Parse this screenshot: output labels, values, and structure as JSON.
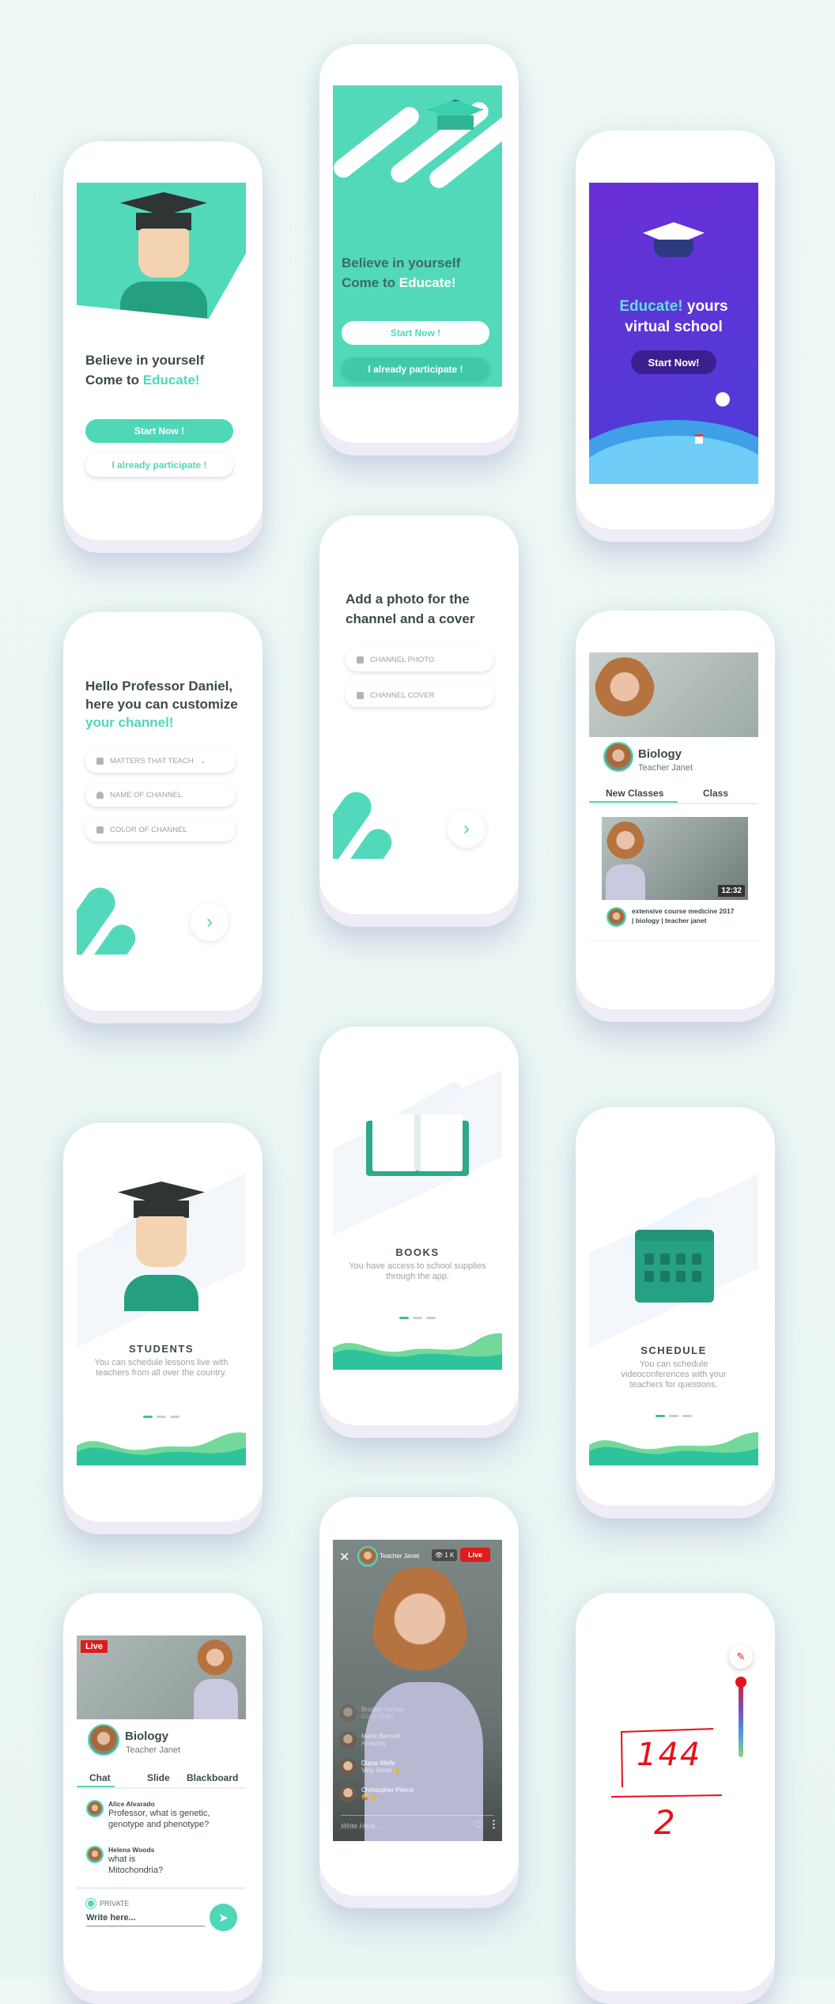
{
  "colors": {
    "background": "#eef8f6",
    "accent": "#4fd8b8",
    "text_dark": "#3b4a4d",
    "text_muted": "#9aa3a6",
    "purple": "#5b36d6",
    "live_red": "#e01b1b"
  },
  "welcome_light": {
    "line1": "Believe in yourself",
    "line2_prefix": "Come to ",
    "brand": "Educate!",
    "start": "Start Now !",
    "participate": "I already participate !"
  },
  "welcome_teal": {
    "line1": "Believe in yourself",
    "line2_prefix": "Come to ",
    "brand": "Educate!",
    "start": "Start Now !",
    "participate": "I already participate !"
  },
  "welcome_purple": {
    "brand": "Educate!",
    "line1_rest": " yours",
    "line2": "virtual school",
    "start": "Start Now!"
  },
  "customize": {
    "line1": "Hello Professor Daniel,",
    "line2": "here you can customize",
    "line3": "your channel!",
    "fields": [
      {
        "icon": "book-icon",
        "label": "MATTERS THAT TEACH"
      },
      {
        "icon": "user-icon",
        "label": "NAME OF CHANNEL"
      },
      {
        "icon": "layers-icon",
        "label": "COLOR OF CHANNEL"
      }
    ]
  },
  "add_photo": {
    "line1": "Add a photo for the",
    "line2": "channel and a cover",
    "fields": [
      {
        "icon": "image-icon",
        "label": "CHANNEL PHOTO"
      },
      {
        "icon": "image-icon",
        "label": "CHANNEL COVER"
      }
    ]
  },
  "channel": {
    "subject": "Biology",
    "teacher": "Teacher Janet",
    "tabs": [
      "New Classes",
      "Class"
    ],
    "video": {
      "duration": "12:32",
      "title_line1": "extensive course medicine 2017",
      "title_line2": "| biology | teacher janet"
    }
  },
  "onboarding": [
    {
      "title": "STUDENTS",
      "desc": "You can schedule lessons live with teachers from all over the country."
    },
    {
      "title": "BOOKS",
      "desc": "You have access to school supplies through the app."
    },
    {
      "title": "SCHEDULE",
      "desc": "You can schedule videoconferences with your teachers for questions."
    }
  ],
  "live_chat": {
    "badge": "Live",
    "subject": "Biology",
    "teacher": "Teacher Janet",
    "tabs": [
      "Chat",
      "Slide",
      "Blackboard"
    ],
    "messages": [
      {
        "author": "Alice Alvarado",
        "text": "Professor, what is genetic, genotype and phenotype?"
      },
      {
        "author": "Helena Woods",
        "text": "what is Mitochondria?"
      }
    ],
    "private_label": "PRIVATE",
    "input_placeholder": "Write here..."
  },
  "live_stream": {
    "teacher": "Teacher Janet",
    "viewers": "1 K",
    "badge": "Live",
    "comments": [
      {
        "author": "Bradley Hunter",
        "text": "Good Night"
      },
      {
        "author": "Marie Bennett",
        "text": "Amazing"
      },
      {
        "author": "Diana Wells",
        "text": "Very Good 👍"
      },
      {
        "author": "Christopher Pierce",
        "text": "😛👍"
      }
    ],
    "input_placeholder": "Write Here..."
  },
  "blackboard": {
    "radicand": "144",
    "denominator": "2"
  }
}
